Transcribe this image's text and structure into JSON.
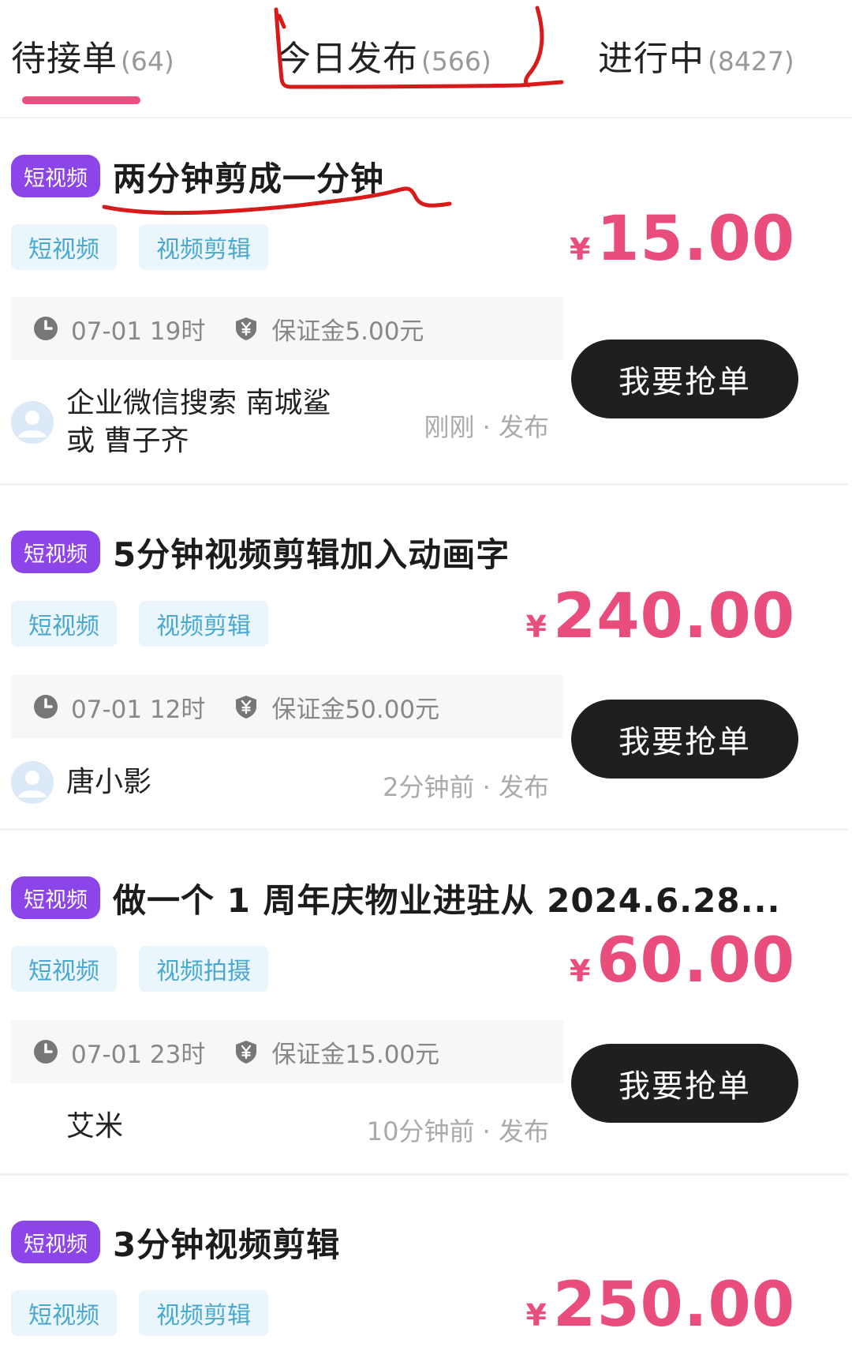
{
  "tabs": [
    {
      "label": "待接单",
      "count": "(64)"
    },
    {
      "label": "今日发布",
      "count": "(566)"
    },
    {
      "label": "进行中",
      "count": "(8427)"
    }
  ],
  "colors": {
    "accent": "#e8517f",
    "price": "#e94d7b",
    "category_badge": "#8b45e8",
    "tag_bg": "#eaf6fb",
    "tag_text": "#4aa8cf",
    "button_bg": "#1f1f22",
    "annotation": "#d81a1a"
  },
  "icons": {
    "deadline": "clock-icon",
    "deposit": "shield-yen-icon",
    "avatar": "user-avatar-icon"
  },
  "orders": [
    {
      "category": "短视频",
      "title": "两分钟剪成一分钟",
      "tags": [
        "短视频",
        "视频剪辑"
      ],
      "currency": "¥",
      "price": "15.00",
      "deadline": "07-01 19时",
      "deposit": "保证金5.00元",
      "button_label": "我要抢单",
      "poster_line1": "企业微信搜索 南城鲨",
      "poster_line2": "或 曹子齐",
      "posted_time": "刚刚 · 发布"
    },
    {
      "category": "短视频",
      "title": "5分钟视频剪辑加入动画字",
      "tags": [
        "短视频",
        "视频剪辑"
      ],
      "currency": "¥",
      "price": "240.00",
      "deadline": "07-01 12时",
      "deposit": "保证金50.00元",
      "button_label": "我要抢单",
      "poster": "唐小影",
      "posted_time": "2分钟前 · 发布"
    },
    {
      "category": "短视频",
      "title": "做一个 1 周年庆物业进驻从 2024.6.28...",
      "tags": [
        "短视频",
        "视频拍摄"
      ],
      "currency": "¥",
      "price": "60.00",
      "deadline": "07-01 23时",
      "deposit": "保证金15.00元",
      "button_label": "我要抢单",
      "poster": "艾米",
      "posted_time": "10分钟前 · 发布"
    },
    {
      "category": "短视频",
      "title": "3分钟视频剪辑",
      "tags": [
        "短视频",
        "视频剪辑"
      ],
      "currency": "¥",
      "price": "250.00"
    }
  ]
}
